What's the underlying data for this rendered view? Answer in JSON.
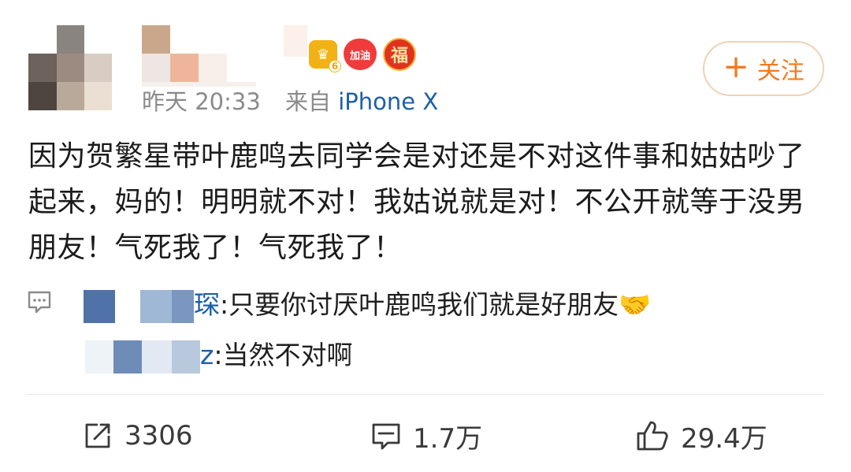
{
  "post": {
    "time": "昨天 20:33",
    "source_prefix": "来自",
    "source_device": "iPhone X",
    "follow_label": "关注",
    "content": "因为贺繁星带叶鹿鸣去同学会是对还是不对这件事和姑姑吵了起来，妈的！明明就不对！我姑说就是对！不公开就等于没男朋友！气死我了！气死我了！"
  },
  "badges": {
    "crown_level": "6",
    "heart_text": "加油",
    "fu_text": "福"
  },
  "comments": [
    {
      "name_suffix": "琛",
      "text": ":只要你讨厌叶鹿鸣我们就是好朋友",
      "emoji": "🤝"
    },
    {
      "name_suffix": "z",
      "text": ":当然不对啊"
    }
  ],
  "actions": {
    "repost_count": "3306",
    "comment_count": "1.7万",
    "like_count": "29.4万"
  },
  "icons": [
    "comment-icon",
    "repost-icon",
    "like-icon"
  ],
  "colors": {
    "link": "#1d5fa6",
    "follow": "#f07b1e",
    "meta": "#8a8a8a"
  }
}
